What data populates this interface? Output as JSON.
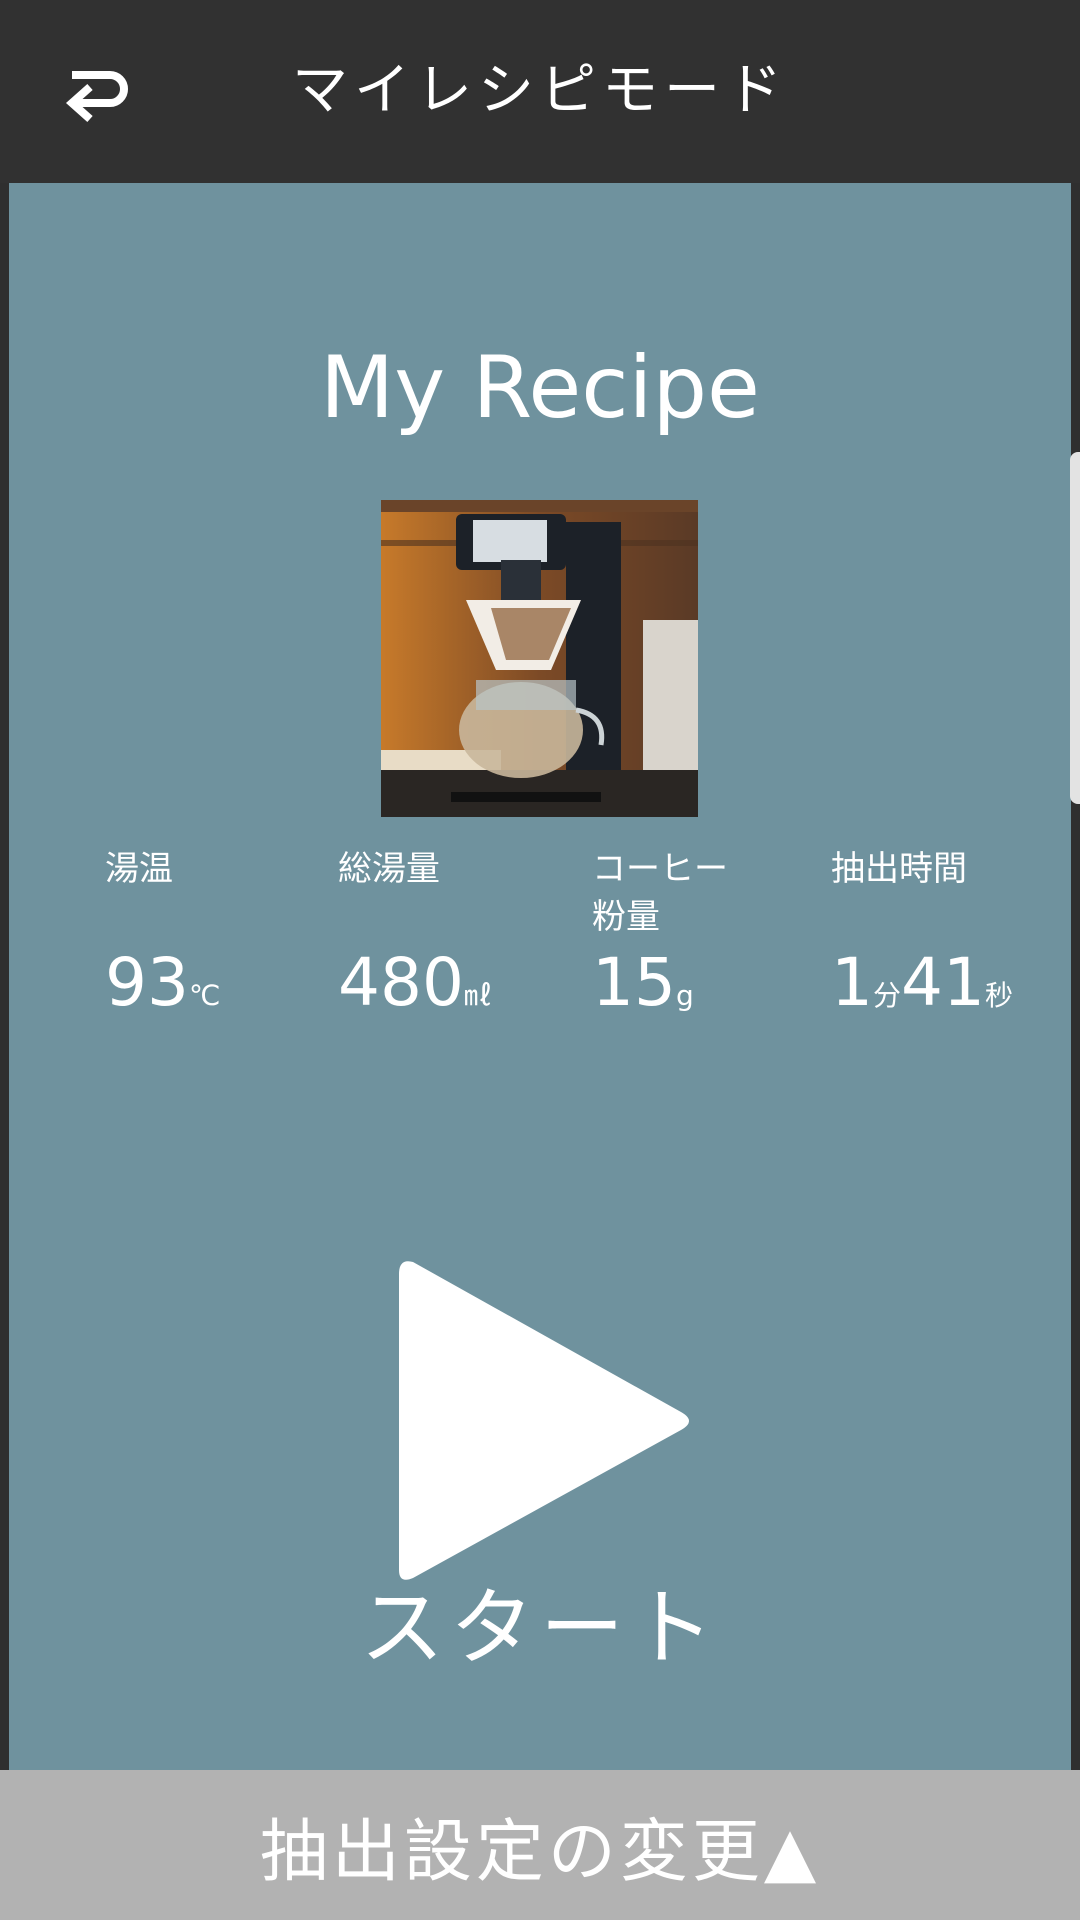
{
  "header": {
    "title": "マイレシピモード",
    "back_icon": "return-arrow-icon"
  },
  "main": {
    "recipe_title": "My Recipe",
    "stats": {
      "temperature": {
        "label": "湯温",
        "value": "93",
        "unit": "℃"
      },
      "total_water": {
        "label": "総湯量",
        "value": "480",
        "unit": "㎖"
      },
      "coffee_powder": {
        "label_line1": "コーヒー",
        "label_line2": "粉量",
        "value": "15",
        "unit": "g"
      },
      "brew_time": {
        "label": "抽出時間",
        "minutes": "1",
        "minutes_unit": "分",
        "seconds": "41",
        "seconds_unit": "秒"
      }
    },
    "play_icon": "play-icon",
    "start_label": "スタート"
  },
  "footer": {
    "label": "抽出設定の変更▲"
  },
  "colors": {
    "header_bg": "#313131",
    "main_bg": "#6f929e",
    "footer_bg": "#b2b2b2",
    "text": "#ffffff"
  }
}
